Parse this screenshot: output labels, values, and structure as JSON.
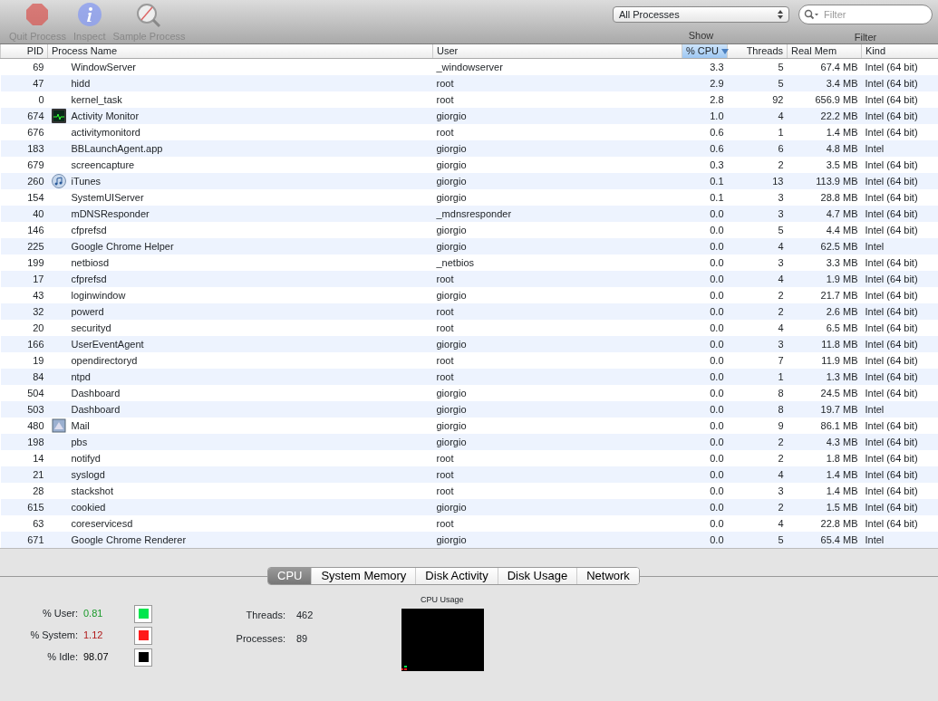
{
  "toolbar": {
    "buttons": [
      {
        "label": "Quit Process",
        "kind": "stop",
        "disabled": true
      },
      {
        "label": "Inspect",
        "kind": "info",
        "disabled": true
      },
      {
        "label": "Sample Process",
        "kind": "sample",
        "disabled": true
      }
    ],
    "show": {
      "label": "Show",
      "value": "All Processes"
    },
    "filter": {
      "label": "Filter",
      "placeholder": "Filter"
    }
  },
  "table": {
    "columns": [
      {
        "label": "PID",
        "sorted": false
      },
      {
        "label": "Process Name",
        "sorted": false
      },
      {
        "label": "User",
        "sorted": false
      },
      {
        "label": "% CPU",
        "sorted": true
      },
      {
        "label": "Threads",
        "sorted": false
      },
      {
        "label": "Real Mem",
        "sorted": false
      },
      {
        "label": "Kind",
        "sorted": false
      }
    ],
    "rows": [
      {
        "pid": "69",
        "name": "WindowServer",
        "kind": "plain",
        "user": "_windowserver",
        "cpu": "3.3",
        "threads": "5",
        "mem": "67.4 MB",
        "arch": "Intel (64 bit)"
      },
      {
        "pid": "47",
        "name": "hidd",
        "kind": "plain",
        "user": "root",
        "cpu": "2.9",
        "threads": "5",
        "mem": "3.4 MB",
        "arch": "Intel (64 bit)"
      },
      {
        "pid": "0",
        "name": "kernel_task",
        "kind": "plain",
        "user": "root",
        "cpu": "2.8",
        "threads": "92",
        "mem": "656.9 MB",
        "arch": "Intel (64 bit)"
      },
      {
        "pid": "674",
        "name": "Activity Monitor",
        "kind": "monitor",
        "user": "giorgio",
        "cpu": "1.0",
        "threads": "4",
        "mem": "22.2 MB",
        "arch": "Intel (64 bit)"
      },
      {
        "pid": "676",
        "name": "activitymonitord",
        "kind": "plain",
        "user": "root",
        "cpu": "0.6",
        "threads": "1",
        "mem": "1.4 MB",
        "arch": "Intel (64 bit)"
      },
      {
        "pid": "183",
        "name": "BBLaunchAgent.app",
        "kind": "plain",
        "user": "giorgio",
        "cpu": "0.6",
        "threads": "6",
        "mem": "4.8 MB",
        "arch": "Intel"
      },
      {
        "pid": "679",
        "name": "screencapture",
        "kind": "plain",
        "user": "giorgio",
        "cpu": "0.3",
        "threads": "2",
        "mem": "3.5 MB",
        "arch": "Intel (64 bit)"
      },
      {
        "pid": "260",
        "name": "iTunes",
        "kind": "disc",
        "user": "giorgio",
        "cpu": "0.1",
        "threads": "13",
        "mem": "113.9 MB",
        "arch": "Intel (64 bit)"
      },
      {
        "pid": "154",
        "name": "SystemUIServer",
        "kind": "plain",
        "user": "giorgio",
        "cpu": "0.1",
        "threads": "3",
        "mem": "28.8 MB",
        "arch": "Intel (64 bit)"
      },
      {
        "pid": "40",
        "name": "mDNSResponder",
        "kind": "plain",
        "user": "_mdnsresponder",
        "cpu": "0.0",
        "threads": "3",
        "mem": "4.7 MB",
        "arch": "Intel (64 bit)"
      },
      {
        "pid": "146",
        "name": "cfprefsd",
        "kind": "plain",
        "user": "giorgio",
        "cpu": "0.0",
        "threads": "5",
        "mem": "4.4 MB",
        "arch": "Intel (64 bit)"
      },
      {
        "pid": "225",
        "name": "Google Chrome Helper",
        "kind": "plain",
        "user": "giorgio",
        "cpu": "0.0",
        "threads": "4",
        "mem": "62.5 MB",
        "arch": "Intel"
      },
      {
        "pid": "199",
        "name": "netbiosd",
        "kind": "plain",
        "user": "_netbios",
        "cpu": "0.0",
        "threads": "3",
        "mem": "3.3 MB",
        "arch": "Intel (64 bit)"
      },
      {
        "pid": "17",
        "name": "cfprefsd",
        "kind": "plain",
        "user": "root",
        "cpu": "0.0",
        "threads": "4",
        "mem": "1.9 MB",
        "arch": "Intel (64 bit)"
      },
      {
        "pid": "43",
        "name": "loginwindow",
        "kind": "plain",
        "user": "giorgio",
        "cpu": "0.0",
        "threads": "2",
        "mem": "21.7 MB",
        "arch": "Intel (64 bit)"
      },
      {
        "pid": "32",
        "name": "powerd",
        "kind": "plain",
        "user": "root",
        "cpu": "0.0",
        "threads": "2",
        "mem": "2.6 MB",
        "arch": "Intel (64 bit)"
      },
      {
        "pid": "20",
        "name": "securityd",
        "kind": "plain",
        "user": "root",
        "cpu": "0.0",
        "threads": "4",
        "mem": "6.5 MB",
        "arch": "Intel (64 bit)"
      },
      {
        "pid": "166",
        "name": "UserEventAgent",
        "kind": "plain",
        "user": "giorgio",
        "cpu": "0.0",
        "threads": "3",
        "mem": "11.8 MB",
        "arch": "Intel (64 bit)"
      },
      {
        "pid": "19",
        "name": "opendirectoryd",
        "kind": "plain",
        "user": "root",
        "cpu": "0.0",
        "threads": "7",
        "mem": "11.9 MB",
        "arch": "Intel (64 bit)"
      },
      {
        "pid": "84",
        "name": "ntpd",
        "kind": "plain",
        "user": "root",
        "cpu": "0.0",
        "threads": "1",
        "mem": "1.3 MB",
        "arch": "Intel (64 bit)"
      },
      {
        "pid": "504",
        "name": "Dashboard",
        "kind": "plain",
        "user": "giorgio",
        "cpu": "0.0",
        "threads": "8",
        "mem": "24.5 MB",
        "arch": "Intel (64 bit)"
      },
      {
        "pid": "503",
        "name": "Dashboard",
        "kind": "plain",
        "user": "giorgio",
        "cpu": "0.0",
        "threads": "8",
        "mem": "19.7 MB",
        "arch": "Intel"
      },
      {
        "pid": "480",
        "name": "Mail",
        "kind": "mail",
        "user": "giorgio",
        "cpu": "0.0",
        "threads": "9",
        "mem": "86.1 MB",
        "arch": "Intel (64 bit)"
      },
      {
        "pid": "198",
        "name": "pbs",
        "kind": "plain",
        "user": "giorgio",
        "cpu": "0.0",
        "threads": "2",
        "mem": "4.3 MB",
        "arch": "Intel (64 bit)"
      },
      {
        "pid": "14",
        "name": "notifyd",
        "kind": "plain",
        "user": "root",
        "cpu": "0.0",
        "threads": "2",
        "mem": "1.8 MB",
        "arch": "Intel (64 bit)"
      },
      {
        "pid": "21",
        "name": "syslogd",
        "kind": "plain",
        "user": "root",
        "cpu": "0.0",
        "threads": "4",
        "mem": "1.4 MB",
        "arch": "Intel (64 bit)"
      },
      {
        "pid": "28",
        "name": "stackshot",
        "kind": "plain",
        "user": "root",
        "cpu": "0.0",
        "threads": "3",
        "mem": "1.4 MB",
        "arch": "Intel (64 bit)"
      },
      {
        "pid": "615",
        "name": "cookied",
        "kind": "plain",
        "user": "giorgio",
        "cpu": "0.0",
        "threads": "2",
        "mem": "1.5 MB",
        "arch": "Intel (64 bit)"
      },
      {
        "pid": "63",
        "name": "coreservicesd",
        "kind": "plain",
        "user": "root",
        "cpu": "0.0",
        "threads": "4",
        "mem": "22.8 MB",
        "arch": "Intel (64 bit)"
      },
      {
        "pid": "671",
        "name": "Google Chrome Renderer",
        "kind": "plain",
        "user": "giorgio",
        "cpu": "0.0",
        "threads": "5",
        "mem": "65.4 MB",
        "arch": "Intel"
      }
    ]
  },
  "tabs": [
    {
      "label": "CPU",
      "selected": true
    },
    {
      "label": "System Memory",
      "selected": false
    },
    {
      "label": "Disk Activity",
      "selected": false
    },
    {
      "label": "Disk Usage",
      "selected": false
    },
    {
      "label": "Network",
      "selected": false
    }
  ],
  "cpu_panel": {
    "stats": [
      {
        "label": "% User:",
        "value": "0.81",
        "color": "#00e64d"
      },
      {
        "label": "% System:",
        "value": "1.12",
        "color": "#ff1a1a"
      },
      {
        "label": "% Idle:",
        "value": "98.07",
        "color": "#000000"
      }
    ],
    "counts": [
      {
        "label": "Threads:",
        "value": "462"
      },
      {
        "label": "Processes:",
        "value": "89"
      }
    ],
    "graph_title": "CPU Usage"
  }
}
